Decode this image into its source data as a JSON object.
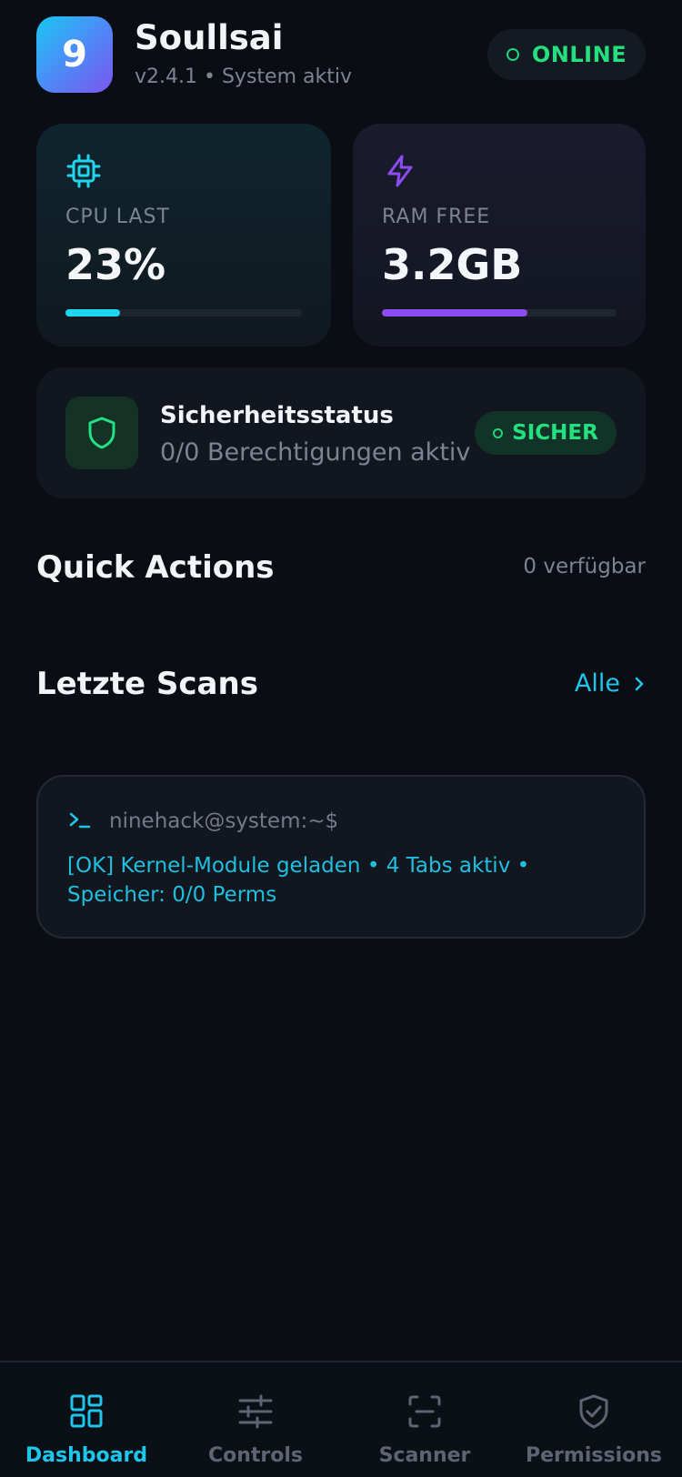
{
  "header": {
    "app_icon_text": "9",
    "title": "Soullsai",
    "subtitle": "v2.4.1 • System aktiv",
    "status": "ONLINE"
  },
  "stats": {
    "cpu": {
      "label": "CPU LAST",
      "value": "23%",
      "fill": 0.23,
      "icon": "cpu-chip-icon"
    },
    "ram": {
      "label": "RAM FREE",
      "value": "3.2GB",
      "fill": 0.62,
      "icon": "lightning-icon"
    }
  },
  "security": {
    "title": "Sicherheitsstatus",
    "subtitle": "0/0 Berechtigungen aktiv",
    "badge": "SICHER",
    "icon": "shield-icon"
  },
  "quick_actions": {
    "title": "Quick Actions",
    "count": "0 verfügbar"
  },
  "scans": {
    "title": "Letzte Scans",
    "all_label": "Alle"
  },
  "terminal": {
    "prompt": "ninehack@system:~$",
    "output": "[OK] Kernel-Module geladen • 4 Tabs aktiv • Speicher: 0/0 Perms"
  },
  "nav": {
    "items": [
      {
        "label": "Dashboard",
        "icon": "dashboard-grid-icon",
        "active": true
      },
      {
        "label": "Controls",
        "icon": "sliders-icon",
        "active": false
      },
      {
        "label": "Scanner",
        "icon": "scan-frame-icon",
        "active": false
      },
      {
        "label": "Permissions",
        "icon": "shield-check-icon",
        "active": false
      }
    ]
  },
  "colors": {
    "background": "#0a0d14",
    "accent_cyan": "#1fc6ec",
    "accent_purple": "#8b4cf0",
    "status_green": "#25e07f"
  }
}
